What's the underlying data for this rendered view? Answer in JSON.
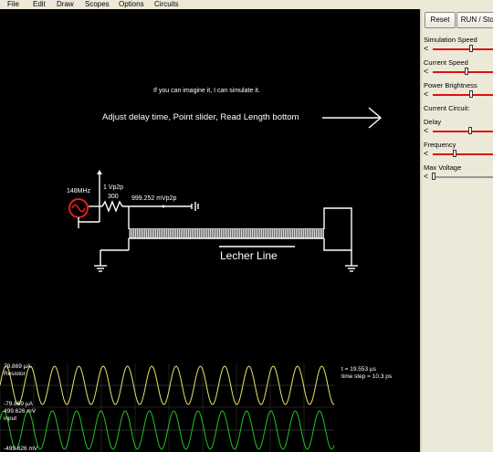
{
  "menu": [
    "File",
    "Edit",
    "Draw",
    "Scopes",
    "Options",
    "Circuits"
  ],
  "buttons": {
    "reset": "Reset",
    "run_stop": "RUN / Stop"
  },
  "sidebar": {
    "simulation_speed": "Simulation Speed",
    "current_speed": "Current Speed",
    "power_brightness": "Power Brightness",
    "current_circuit_label": "Current Circuit:",
    "delay": "Delay",
    "frequency": "Frequency",
    "max_voltage": "Max Voltage"
  },
  "sliders": {
    "simulation_speed": 0.62,
    "current_speed": 0.55,
    "power_brightness": 0.62,
    "delay": 0.6,
    "frequency": 0.35,
    "max_voltage": 0.0
  },
  "canvas": {
    "tagline": "If you can imagine it, I can simulate it.",
    "instruction": "Adjust delay time, Point slider, Read Length bottom",
    "source_freq": "148MHz",
    "source_amp": "1 Vp2p",
    "resistor_value": "300",
    "probe_value": "999.252 mVp2p",
    "line_label": "Lecher Line"
  },
  "scope": {
    "trace1_value": "79.869 µA",
    "trace1_name": "Resistor",
    "trace2_min": "-79.869 µA",
    "trace2_max": "499.626 mV",
    "trace2_name": "input",
    "trace2_bottom": "-499.626 mV",
    "time": "t = 19.553 µs",
    "time_step": "time step = 10.3 ps"
  },
  "colors": {
    "wire": "#ffffff",
    "source": "#e02020",
    "trace_yellow": "#e6e66e",
    "trace_green": "#22c422",
    "slider_track": "#dd1111"
  }
}
